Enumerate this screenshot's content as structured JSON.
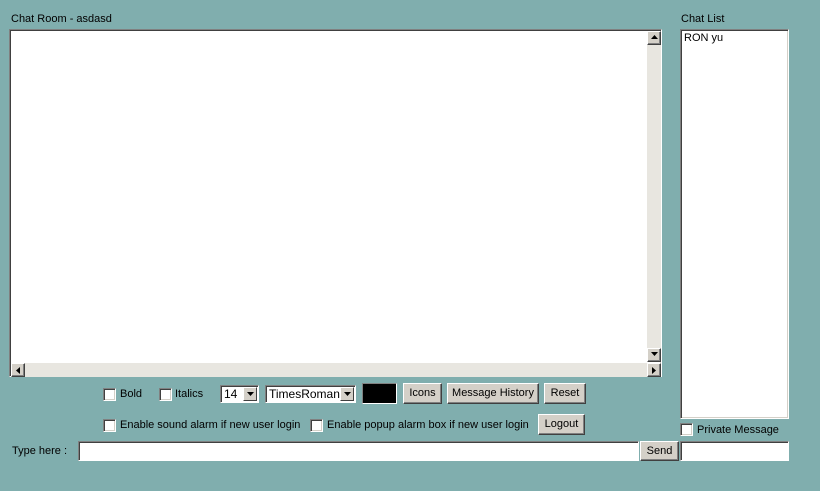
{
  "chat_room": {
    "title": "Chat Room - asdasd",
    "messages": []
  },
  "chat_list": {
    "title": "Chat List",
    "users": [
      "RON yu"
    ],
    "private_message_label": "Private Message",
    "private_message_value": ""
  },
  "formatting": {
    "bold_label": "Bold",
    "italics_label": "Italics",
    "font_size": "14",
    "font_family": "TimesRoman",
    "text_color": "#000000",
    "icons_label": "Icons",
    "message_history_label": "Message History",
    "reset_label": "Reset"
  },
  "alarms": {
    "sound_alarm_label": "Enable sound alarm if new user login",
    "popup_alarm_label": "Enable popup alarm box if new user login",
    "logout_label": "Logout"
  },
  "composer": {
    "type_here_label": "Type here :",
    "message_value": "",
    "send_label": "Send"
  },
  "colors": {
    "background": "#80aeae",
    "button_face": "#d4d0c8"
  }
}
